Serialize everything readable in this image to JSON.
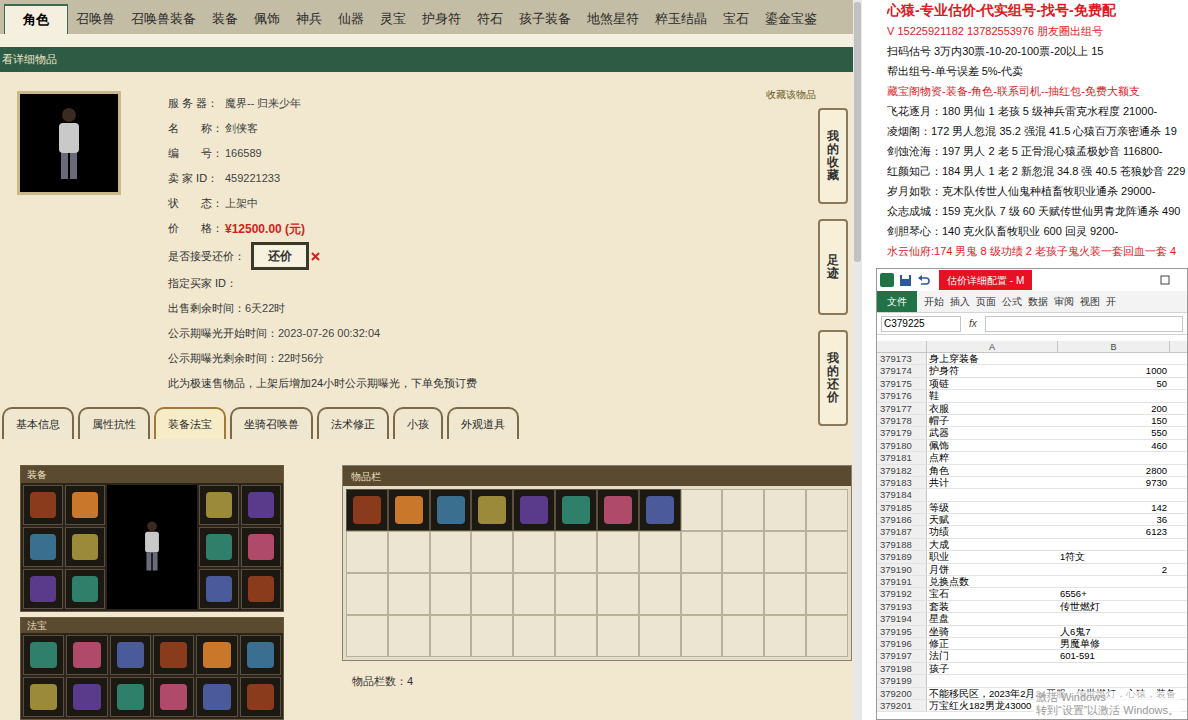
{
  "site_tabs": [
    {
      "label": "角色",
      "selected": true
    },
    {
      "label": "召唤兽",
      "selected": false
    },
    {
      "label": "召唤兽装备",
      "selected": false
    },
    {
      "label": "装备",
      "selected": false
    },
    {
      "label": "佩饰",
      "selected": false
    },
    {
      "label": "神兵",
      "selected": false
    },
    {
      "label": "仙器",
      "selected": false
    },
    {
      "label": "灵宝",
      "selected": false
    },
    {
      "label": "护身符",
      "selected": false
    },
    {
      "label": "符石",
      "selected": false
    },
    {
      "label": "孩子装备",
      "selected": false
    },
    {
      "label": "地煞星符",
      "selected": false
    },
    {
      "label": "粹玉结晶",
      "selected": false
    },
    {
      "label": "宝石",
      "selected": false
    },
    {
      "label": "鎏金宝鉴",
      "selected": false
    }
  ],
  "breadcrumb": "看详细物品",
  "favorite_link": "收藏该物品",
  "info_rows": [
    {
      "label": "服 务 器：",
      "value": "魔界-- 归来少年",
      "kind": "text"
    },
    {
      "label": "名　　称：",
      "value": "剑侠客",
      "kind": "text"
    },
    {
      "label": "编　　号：",
      "value": "166589",
      "kind": "text"
    },
    {
      "label": "卖 家 ID：",
      "value": "459221233",
      "kind": "text"
    },
    {
      "label": "状　　态：",
      "value": "上架中",
      "kind": "text"
    },
    {
      "label": "价　　格：",
      "value": "¥12500.00 (元)",
      "kind": "price"
    },
    {
      "label": "是否接受还价：",
      "value": "还价",
      "kind": "button"
    },
    {
      "label": "指定买家 ID：",
      "value": "",
      "kind": "text"
    },
    {
      "label": "出售剩余时间：",
      "value": "6天22时",
      "kind": "text"
    },
    {
      "label": "公示期曝光开始时间：",
      "value": "2023-07-26 00:32:04",
      "kind": "text"
    },
    {
      "label": "公示期曝光剩余时间：",
      "value": "22时56分",
      "kind": "text"
    }
  ],
  "note": "此为极速售物品，上架后增加24小时公示期曝光，下单免预订费",
  "side_buttons": [
    "我的收藏",
    "足迹",
    "我的还价"
  ],
  "detail_tabs": [
    {
      "label": "基本信息",
      "selected": false
    },
    {
      "label": "属性抗性",
      "selected": false
    },
    {
      "label": "装备法宝",
      "selected": true
    },
    {
      "label": "坐骑召唤兽",
      "selected": false
    },
    {
      "label": "法术修正",
      "selected": false
    },
    {
      "label": "小孩",
      "selected": false
    },
    {
      "label": "外观道具",
      "selected": false
    }
  ],
  "equipment": {
    "title": "装备",
    "slots": [
      true,
      true,
      true,
      true,
      true,
      true,
      true,
      true,
      true,
      true,
      true,
      true
    ]
  },
  "fabao": {
    "title": "法宝",
    "slots": [
      true,
      true,
      true,
      true,
      true,
      true,
      true,
      true,
      true,
      true,
      true,
      true
    ]
  },
  "inventory": {
    "title": "物品栏",
    "count_label": "物品栏数：4",
    "slots": [
      true,
      true,
      true,
      true,
      true,
      true,
      true,
      true,
      false,
      false,
      false,
      false,
      false,
      false,
      false,
      false,
      false,
      false,
      false,
      false,
      false,
      false,
      false,
      false,
      false,
      false,
      false,
      false,
      false,
      false,
      false,
      false,
      false,
      false,
      false,
      false,
      false,
      false,
      false,
      false,
      false,
      false,
      false,
      false,
      false,
      false,
      false,
      false
    ]
  },
  "ads": [
    {
      "text": "心猿-专业估价-代实组号-找号-免费配",
      "color": "#e0191e"
    },
    {
      "text": "V 15225921182   13782553976 朋友圈出组号",
      "color": "#e0191e"
    },
    {
      "text": "扫码估号 3万内30票-10-20-100票-20以上 15",
      "color": "#111111"
    },
    {
      "text": "帮出组号-单号误差 5%-代卖",
      "color": "#111111"
    },
    {
      "text": "藏宝阁物资-装备-角色-联系司机--抽红包-免费大额支",
      "color": "#e0191e"
    },
    {
      "text": "飞花逐月：180 男仙 1 老孩 5 级神兵雷克水程度 21000-",
      "color": "#111111"
    },
    {
      "text": "凌烟阁：172 男人忽混 35.2 强混 41.5 心猿百万亲密通杀 19",
      "color": "#111111"
    },
    {
      "text": "剑蚀沧海：197 男人 2 老 5 正骨混心猿孟极妙音 116800-",
      "color": "#111111"
    },
    {
      "text": "红颜知己：184 男人 1 老 2 新忽混 34.8 强 40.5 苍狼妙音 229",
      "color": "#111111"
    },
    {
      "text": "岁月如歌：克木队传世人仙鬼种植畜牧职业通杀 29000-",
      "color": "#111111"
    },
    {
      "text": "众志成城：159 克火队 7 级 60 天赋传世仙男青龙阵通杀 490",
      "color": "#111111"
    },
    {
      "text": "剑胆琴心：140 克火队畜牧职业 600 回灵 9200-",
      "color": "#111111"
    },
    {
      "text": "水云仙府:174 男鬼 8 级功绩 2 老孩子鬼火装一套回血一套 4",
      "color": "#e0191e"
    }
  ],
  "excel": {
    "title": "估价详细配置 - M",
    "ribbon_tabs": [
      {
        "label": "文件",
        "selected": true
      },
      {
        "label": "开始",
        "selected": false
      },
      {
        "label": "插入",
        "selected": false
      },
      {
        "label": "页面",
        "selected": false
      },
      {
        "label": "公式",
        "selected": false
      },
      {
        "label": "数据",
        "selected": false
      },
      {
        "label": "审阅",
        "selected": false
      },
      {
        "label": "视图",
        "selected": false
      },
      {
        "label": "开",
        "selected": false
      }
    ],
    "name_box": "C379225",
    "fx": "fx",
    "columns": [
      "A",
      "B"
    ],
    "rows": [
      {
        "n": "379173",
        "a": "身上穿装备",
        "b": ""
      },
      {
        "n": "379174",
        "a": "护身符",
        "b": "1000"
      },
      {
        "n": "379175",
        "a": "项链",
        "b": "50"
      },
      {
        "n": "379176",
        "a": "鞋",
        "b": ""
      },
      {
        "n": "379177",
        "a": "衣服",
        "b": "200"
      },
      {
        "n": "379178",
        "a": "帽子",
        "b": "150"
      },
      {
        "n": "379179",
        "a": "武器",
        "b": "550"
      },
      {
        "n": "379180",
        "a": "佩饰",
        "b": "460"
      },
      {
        "n": "379181",
        "a": "点粹",
        "b": ""
      },
      {
        "n": "379182",
        "a": "角色",
        "b": "2800"
      },
      {
        "n": "379183",
        "a": "共计",
        "b": "9730"
      },
      {
        "n": "379184",
        "a": "",
        "b": ""
      },
      {
        "n": "379185",
        "a": "等级",
        "b": "142"
      },
      {
        "n": "379186",
        "a": "天赋",
        "b": "36"
      },
      {
        "n": "379187",
        "a": "功绩",
        "b": "6123"
      },
      {
        "n": "379188",
        "a": "大成",
        "b": ""
      },
      {
        "n": "379189",
        "a": "职业",
        "b": "1符文"
      },
      {
        "n": "379190",
        "a": "月饼",
        "b": "2"
      },
      {
        "n": "379191",
        "a": "兑换点数",
        "b": ""
      },
      {
        "n": "379192",
        "a": "宝石",
        "b": "6556+"
      },
      {
        "n": "379193",
        "a": "套装",
        "b": "传世燃灯"
      },
      {
        "n": "379194",
        "a": "星盘",
        "b": ""
      },
      {
        "n": "379195",
        "a": "坐骑",
        "b": "人6鬼7"
      },
      {
        "n": "379196",
        "a": "修正",
        "b": "男魔单修"
      },
      {
        "n": "379197",
        "a": "法门",
        "b": "601-591"
      },
      {
        "n": "379198",
        "a": "孩子",
        "b": ""
      },
      {
        "n": "379199",
        "a": "",
        "b": ""
      },
      {
        "n": "379200",
        "a": "不能移民区，2023年2月24开服，传世燃灯，心猿，装备",
        "b": ""
      },
      {
        "n": "379201",
        "a": "万宝红火182男龙43000",
        "b": ""
      }
    ],
    "watermark": [
      "激活 Windows",
      "转到“设置”以激活 Windows。"
    ]
  }
}
